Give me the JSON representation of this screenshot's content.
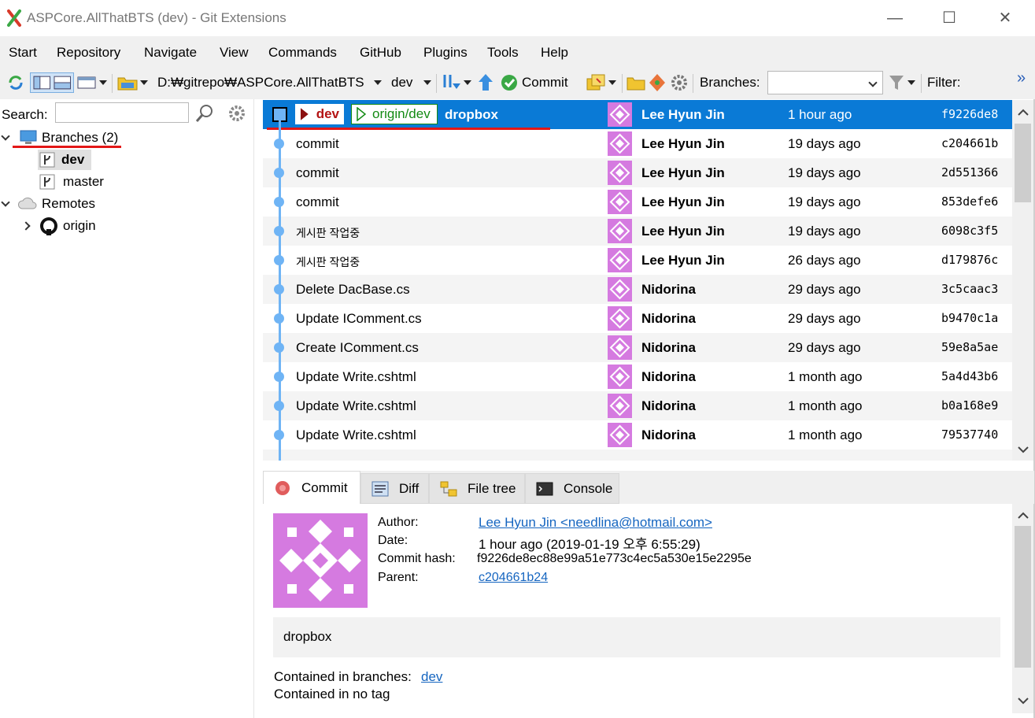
{
  "window": {
    "title": "ASPCore.AllThatBTS (dev) - Git Extensions",
    "controls": {
      "minimize": "—",
      "maximize": "☐",
      "close": "✕"
    }
  },
  "menu": [
    "Start",
    "Repository",
    "Navigate",
    "View",
    "Commands",
    "GitHub",
    "Plugins",
    "Tools",
    "Help"
  ],
  "toolbar": {
    "repo_path": "D:₩gitrepo₩ASPCore.AllThatBTS",
    "branch": "dev",
    "commit_label": "Commit",
    "branches_label": "Branches:",
    "branches_value": "",
    "filter_label": "Filter:",
    "overflow": "»"
  },
  "left": {
    "search_label": "Search:",
    "search_value": "",
    "branches_node": "Branches (2)",
    "branches": [
      "dev",
      "master"
    ],
    "remotes_node": "Remotes",
    "remotes": [
      "origin"
    ]
  },
  "graph": {
    "selected": {
      "local_branch": "dev",
      "remote_branch": "origin/dev",
      "message": "dropbox",
      "author": "Lee Hyun Jin",
      "date": "1 hour ago",
      "hash": "f9226de8"
    },
    "rows": [
      {
        "message": "commit",
        "author": "Lee Hyun Jin",
        "date": "19 days ago",
        "hash": "c204661b"
      },
      {
        "message": "commit",
        "author": "Lee Hyun Jin",
        "date": "19 days ago",
        "hash": "2d551366"
      },
      {
        "message": "commit",
        "author": "Lee Hyun Jin",
        "date": "19 days ago",
        "hash": "853defe6"
      },
      {
        "message": "게시판 작업중",
        "author": "Lee Hyun Jin",
        "date": "19 days ago",
        "hash": "6098c3f5"
      },
      {
        "message": "게시판 작업중",
        "author": "Lee Hyun Jin",
        "date": "26 days ago",
        "hash": "d179876c"
      },
      {
        "message": "Delete DacBase.cs",
        "author": "Nidorina",
        "date": "29 days ago",
        "hash": "3c5caac3"
      },
      {
        "message": "Update IComment.cs",
        "author": "Nidorina",
        "date": "29 days ago",
        "hash": "b9470c1a"
      },
      {
        "message": "Create IComment.cs",
        "author": "Nidorina",
        "date": "29 days ago",
        "hash": "59e8a5ae"
      },
      {
        "message": "Update Write.cshtml",
        "author": "Nidorina",
        "date": "1 month ago",
        "hash": "5a4d43b6"
      },
      {
        "message": "Update Write.cshtml",
        "author": "Nidorina",
        "date": "1 month ago",
        "hash": "b0a168e9"
      },
      {
        "message": "Update Write.cshtml",
        "author": "Nidorina",
        "date": "1 month ago",
        "hash": "79537740"
      }
    ]
  },
  "tabs": [
    "Commit",
    "Diff",
    "File tree",
    "Console"
  ],
  "commit_info": {
    "author_label": "Author:",
    "author": "Lee Hyun Jin <needlina@hotmail.com>",
    "date_label": "Date:",
    "date": "1 hour ago (2019-01-19 오후 6:55:29)",
    "hash_label": "Commit hash:",
    "hash": "f9226de8ec88e99a51e773c4ec5a530e15e2295e",
    "parent_label": "Parent:",
    "parent": "c204661b24",
    "message": "dropbox",
    "branches_label": "Contained in branches:",
    "branches": "dev",
    "tags": "Contained in no tag"
  },
  "colors": {
    "selection": "#0a7ad6",
    "graph": "#6fb4f5",
    "avatar": "#d57ae0",
    "annotation": "#e31717"
  }
}
